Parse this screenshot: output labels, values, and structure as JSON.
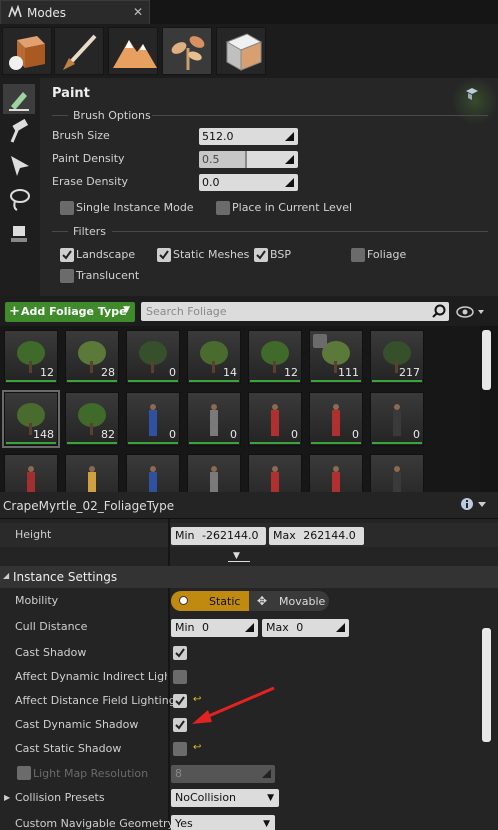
{
  "window": {
    "title": "Modes"
  },
  "modes": [
    "place-icon",
    "paint-brush-icon",
    "landscape-icon",
    "foliage-icon",
    "geometry-icon"
  ],
  "panel": {
    "title": "Paint",
    "brush_options_label": "Brush Options",
    "filters_label": "Filters",
    "brush_size": {
      "label": "Brush Size",
      "value": "512.0"
    },
    "paint_density": {
      "label": "Paint Density",
      "value": "0.5"
    },
    "erase_density": {
      "label": "Erase Density",
      "value": "0.0"
    },
    "single_instance_mode": {
      "label": "Single Instance Mode",
      "checked": false
    },
    "place_in_current_level": {
      "label": "Place in Current Level",
      "checked": false
    },
    "filters": [
      {
        "label": "Landscape",
        "checked": true
      },
      {
        "label": "Static Meshes",
        "checked": true
      },
      {
        "label": "BSP",
        "checked": true
      },
      {
        "label": "Foliage",
        "checked": false
      },
      {
        "label": "Translucent",
        "checked": false
      }
    ]
  },
  "toolbar": {
    "add_label": "Add Foliage Type",
    "search_placeholder": "Search Foliage"
  },
  "foliage_tiles": [
    {
      "count": "12"
    },
    {
      "count": "28"
    },
    {
      "count": "0"
    },
    {
      "count": "14"
    },
    {
      "count": "12"
    },
    {
      "count": "111"
    },
    {
      "count": "217"
    },
    {
      "count": "148"
    },
    {
      "count": "82"
    },
    {
      "count": "0"
    },
    {
      "count": "0"
    },
    {
      "count": "0"
    },
    {
      "count": "0"
    },
    {
      "count": "0"
    },
    {
      "count": ""
    },
    {
      "count": ""
    },
    {
      "count": ""
    },
    {
      "count": ""
    },
    {
      "count": ""
    },
    {
      "count": ""
    },
    {
      "count": ""
    }
  ],
  "details": {
    "object_name": "CrapeMyrtle_02_FoliageType",
    "height": {
      "label": "Height",
      "min_label": "Min",
      "min_value": "-262144.0",
      "max_label": "Max",
      "max_value": "262144.0"
    },
    "section_title": "Instance Settings",
    "mobility": {
      "label": "Mobility",
      "static": "Static",
      "movable": "Movable"
    },
    "cull_distance": {
      "label": "Cull Distance",
      "min_label": "Min",
      "min_value": "0",
      "max_label": "Max",
      "max_value": "0"
    },
    "cast_shadow": {
      "label": "Cast Shadow",
      "checked": true
    },
    "affect_dynamic_indirect": {
      "label": "Affect Dynamic Indirect Lighting",
      "checked": false
    },
    "affect_distance_field": {
      "label": "Affect Distance Field Lighting",
      "checked": true
    },
    "cast_dynamic_shadow": {
      "label": "Cast Dynamic Shadow",
      "checked": true
    },
    "cast_static_shadow": {
      "label": "Cast Static Shadow",
      "checked": false
    },
    "light_map_resolution": {
      "label": "Light Map Resolution",
      "value": "8"
    },
    "collision_presets": {
      "label": "Collision Presets",
      "value": "NoCollision"
    },
    "custom_nav_geometry": {
      "label": "Custom Navigable Geometry",
      "value": "Yes"
    }
  },
  "colors": {
    "accent_green": "#3f8a2b",
    "static_gold": "#c08a10",
    "annotation_red": "#e32222"
  }
}
